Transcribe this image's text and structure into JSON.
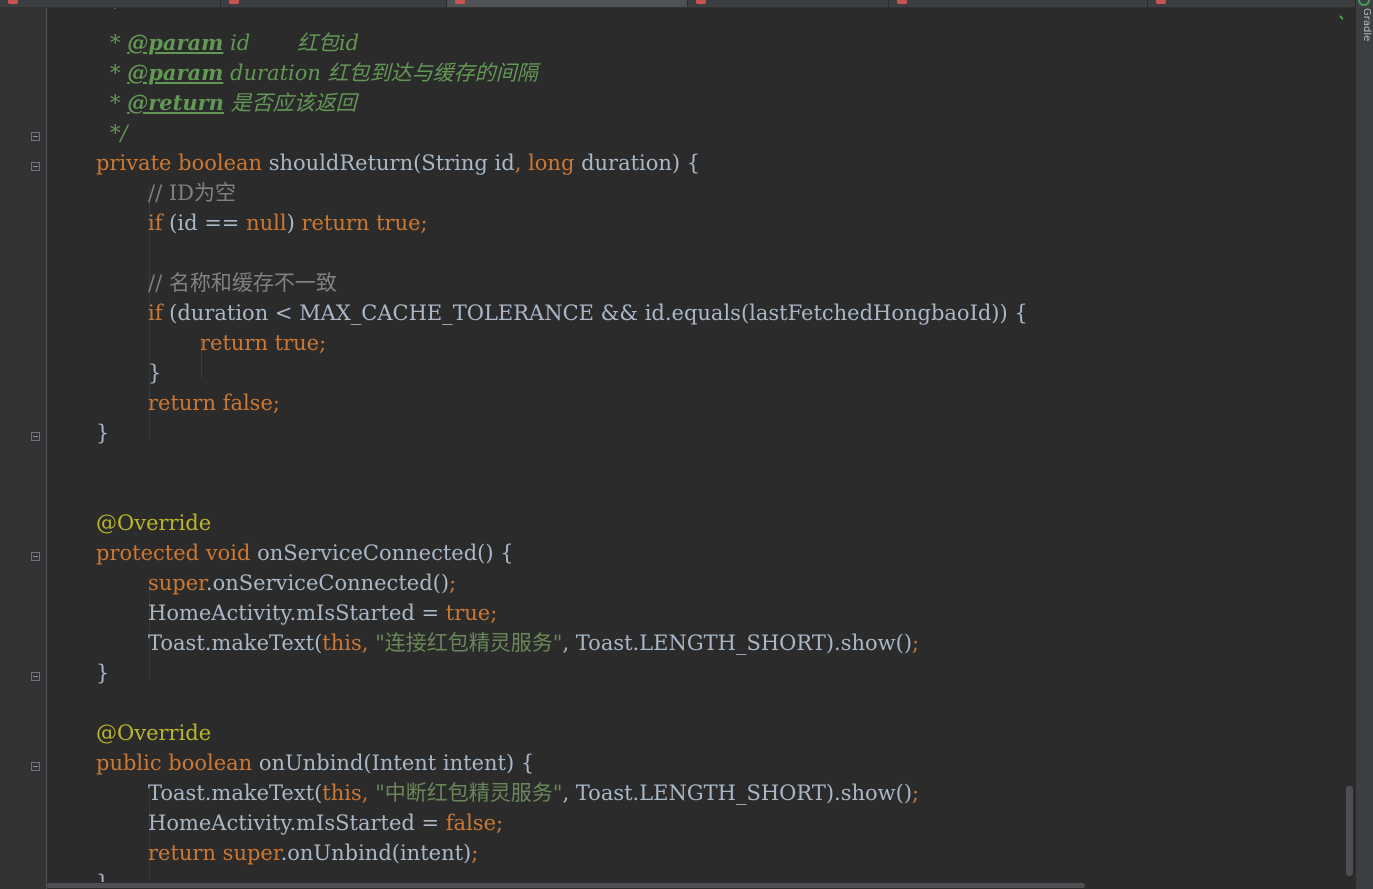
{
  "editor": {
    "lines": {
      "l0": {
        "star": "*"
      },
      "l1": {
        "star": "* ",
        "tag": "@param",
        "text": " id       红包id"
      },
      "l2": {
        "star": "* ",
        "tag": "@param",
        "text": " duration 红包到达与缓存的间隔"
      },
      "l3": {
        "star": "* ",
        "tag": "@return",
        "text": " 是否应该返回"
      },
      "l4": {
        "text": "*/"
      },
      "l5": {
        "kw1": "private ",
        "kw2": "boolean ",
        "rest": "shouldReturn(String id",
        "comma": ",",
        "kw3": " long ",
        "tail": "duration) {"
      },
      "l6": {
        "comment": "// ID为空"
      },
      "l7": {
        "kw1": "if ",
        "mid": "(id == ",
        "kw2": "null",
        "paren": ") ",
        "kw3": "return true;"
      },
      "l9": {
        "comment": "// 名称和缓存不一致"
      },
      "l10": {
        "kw1": "if ",
        "rest": "(duration < MAX_CACHE_TOLERANCE && id.equals(lastFetchedHongbaoId)) {"
      },
      "l11": {
        "kw1": "return true;"
      },
      "l12": {
        "text": "}"
      },
      "l13": {
        "kw1": "return false;"
      },
      "l14": {
        "text": "}"
      },
      "l17": {
        "text": "@Override"
      },
      "l18": {
        "kw1": "protected ",
        "kw2": "void ",
        "rest": "onServiceConnected() {"
      },
      "l19": {
        "kw1": "super",
        "rest": ".onServiceConnected()",
        "semi": ";"
      },
      "l20": {
        "rest": "HomeActivity.mIsStarted = ",
        "kw1": "true;"
      },
      "l21": {
        "rest": "Toast.makeText(",
        "kw1": "this",
        "comma": ", ",
        "str": "\"连接红包精灵服务\"",
        "tail": ", Toast.LENGTH_SHORT).show()",
        "semi": ";"
      },
      "l22": {
        "text": "}"
      },
      "l24": {
        "text": "@Override"
      },
      "l25": {
        "kw1": "public ",
        "kw2": "boolean ",
        "rest": "onUnbind(Intent intent) {"
      },
      "l26": {
        "rest": "Toast.makeText(",
        "kw1": "this",
        "comma": ", ",
        "str": "\"中断红包精灵服务\"",
        "tail": ", Toast.LENGTH_SHORT).show()",
        "semi": ";"
      },
      "l27": {
        "rest": "HomeActivity.mIsStarted = ",
        "kw1": "false;"
      },
      "l28": {
        "kw1": "return ",
        "kw2": "super",
        "rest": ".onUnbind(intent)",
        "semi": ";"
      },
      "l29": {
        "text": "}"
      }
    }
  },
  "sidebar": {
    "gradle_label": "Gradle"
  },
  "colors": {
    "background": "#2b2b2b",
    "keyword": "#cc7832",
    "string": "#6a8759",
    "comment": "#808080",
    "javadoc": "#629755",
    "default": "#a9b7c6"
  }
}
